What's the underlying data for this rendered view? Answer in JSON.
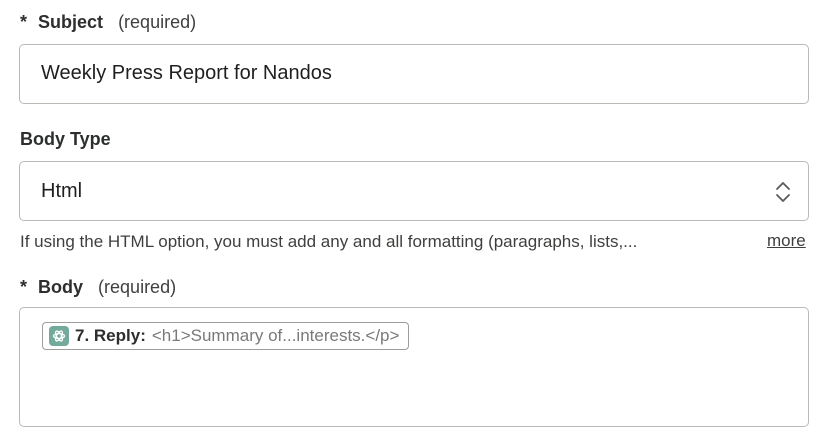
{
  "subject": {
    "asterisk": "*",
    "label": "Subject",
    "required_note": "(required)",
    "value": "Weekly Press Report for Nandos"
  },
  "body_type": {
    "label": "Body Type",
    "value": "Html",
    "help_text": "If using the HTML option, you must add any and all formatting (paragraphs, lists,...",
    "more_link": "more"
  },
  "body": {
    "asterisk": "*",
    "label": "Body",
    "required_note": "(required)",
    "pill": {
      "icon": "openai-icon",
      "icon_color": "#74aa9c",
      "step_label": "7. Reply:",
      "value": "<h1>Summary of...interests.</p>"
    }
  }
}
